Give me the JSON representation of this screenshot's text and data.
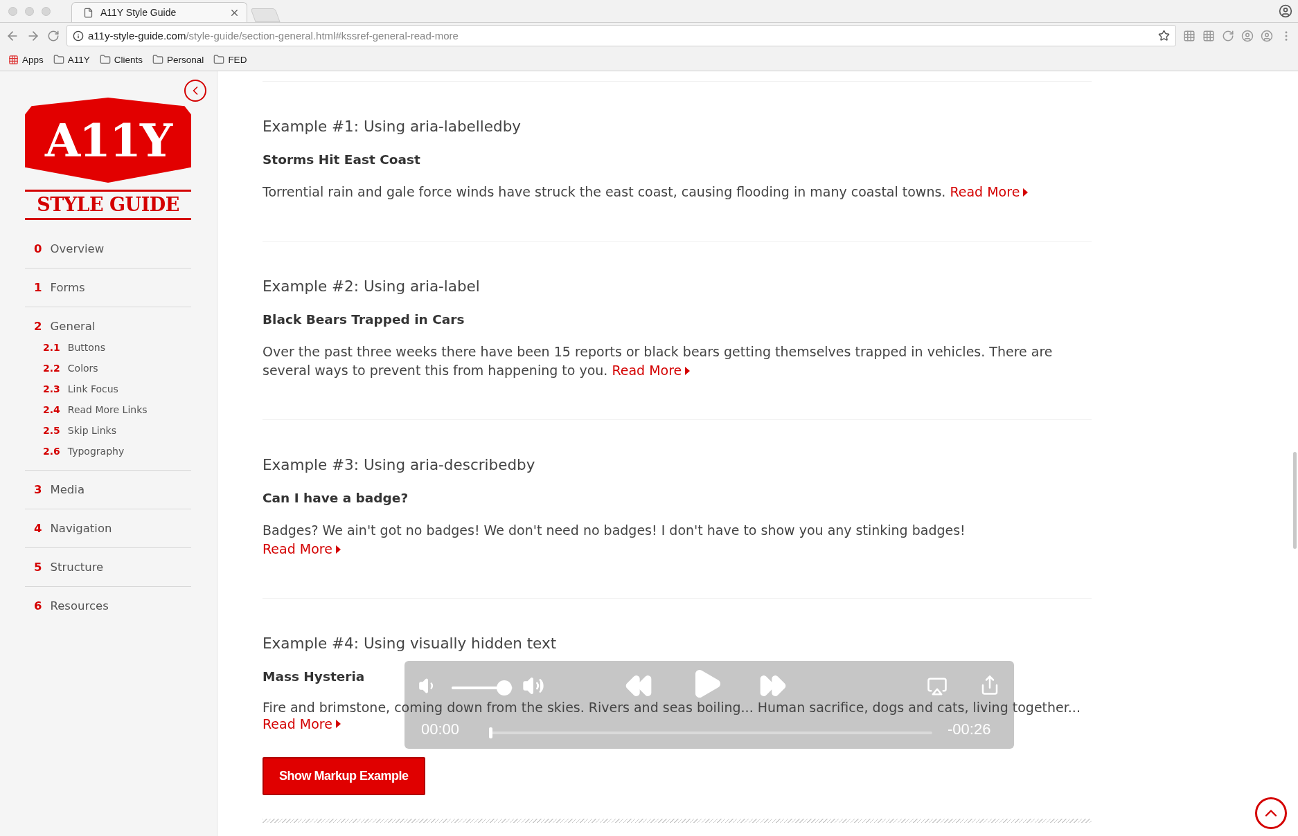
{
  "browser": {
    "tab_title": "A11Y Style Guide",
    "url_host": "a11y-style-guide.com",
    "url_path": "/style-guide/section-general.html#kssref-general-read-more",
    "bookmarks": [
      {
        "kind": "apps",
        "label": "Apps"
      },
      {
        "kind": "folder",
        "label": "A11Y"
      },
      {
        "kind": "folder",
        "label": "Clients"
      },
      {
        "kind": "folder",
        "label": "Personal"
      },
      {
        "kind": "folder",
        "label": "FED"
      }
    ]
  },
  "sidebar": {
    "logo_top": "A11Y",
    "logo_bottom": "STYLE GUIDE",
    "nav": [
      {
        "number": "0",
        "label": "Overview"
      },
      {
        "number": "1",
        "label": "Forms"
      },
      {
        "number": "2",
        "label": "General",
        "children": [
          {
            "number": "2.1",
            "label": "Buttons"
          },
          {
            "number": "2.2",
            "label": "Colors"
          },
          {
            "number": "2.3",
            "label": "Link Focus"
          },
          {
            "number": "2.4",
            "label": "Read More Links"
          },
          {
            "number": "2.5",
            "label": "Skip Links"
          },
          {
            "number": "2.6",
            "label": "Typography"
          }
        ]
      },
      {
        "number": "3",
        "label": "Media"
      },
      {
        "number": "4",
        "label": "Navigation"
      },
      {
        "number": "5",
        "label": "Structure"
      },
      {
        "number": "6",
        "label": "Resources"
      }
    ]
  },
  "examples": [
    {
      "heading": "Example #1: Using aria-labelledby",
      "title": "Storms Hit East Coast",
      "text": "Torrential rain and gale force winds have struck the east coast, causing flooding in many coastal towns.",
      "link": "Read More"
    },
    {
      "heading": "Example #2: Using aria-label",
      "title": "Black Bears Trapped in Cars",
      "text": "Over the past three weeks there have been 15 reports or black bears getting themselves trapped in vehicles. There are several ways to prevent this from happening to you.",
      "link": "Read More"
    },
    {
      "heading": "Example #3: Using aria-describedby",
      "title": "Can I have a badge?",
      "text": "Badges? We ain't got no badges! We don't need no badges! I don't have to show you any stinking badges!",
      "link": "Read More"
    },
    {
      "heading": "Example #4: Using visually hidden text",
      "title": "Mass Hysteria",
      "text": "Fire and brimstone, coming down from the skies. Rivers and seas boiling... Human sacrifice, dogs and cats, living together...",
      "link": "Read More"
    }
  ],
  "player": {
    "volume": {
      "level": 0.86
    },
    "progress": {
      "level": 0
    },
    "elapsed": "00:00",
    "remaining": "-00:26"
  },
  "markup_button": "Show Markup Example"
}
